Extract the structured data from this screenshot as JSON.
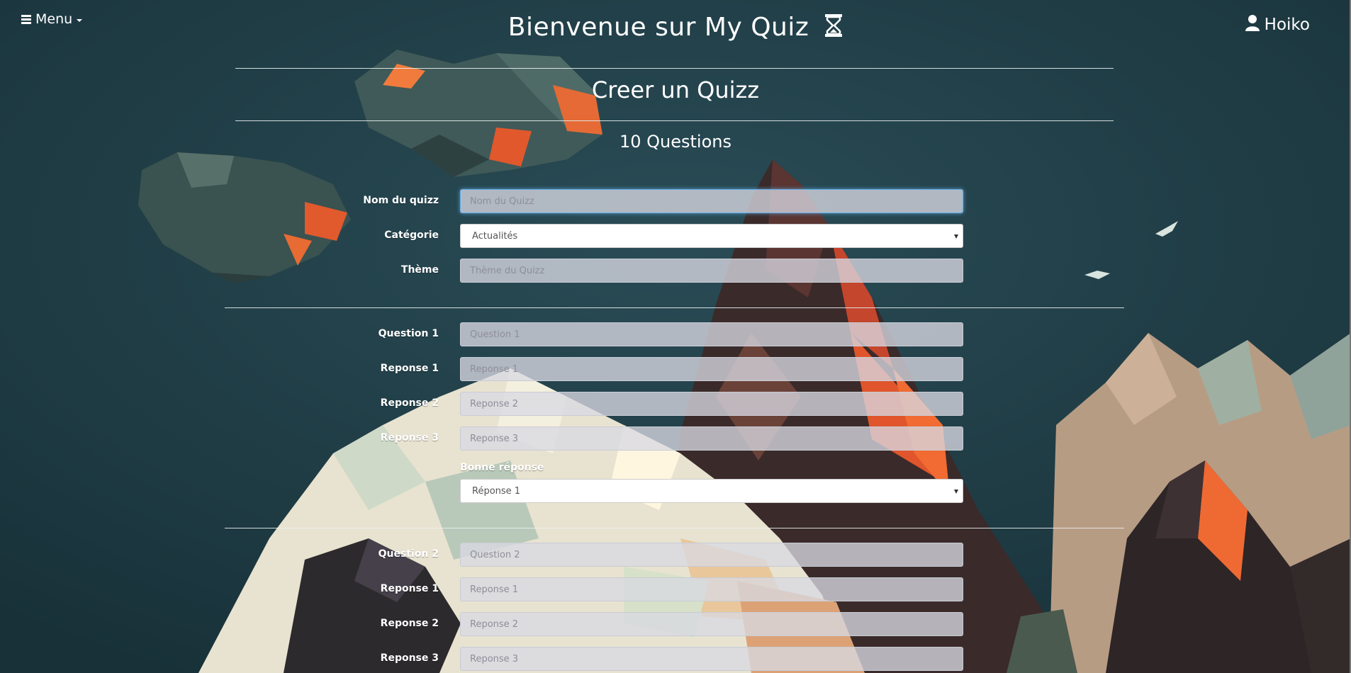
{
  "nav": {
    "menu_label": "Menu",
    "user_name": "Hoiko"
  },
  "site": {
    "title": "Bienvenue sur My Quiz"
  },
  "page": {
    "heading": "Creer un Quizz",
    "question_count": "10 Questions"
  },
  "quiz_meta": {
    "name_label": "Nom du quizz",
    "name_placeholder": "Nom du Quizz",
    "category_label": "Catégorie",
    "category_value": "Actualités",
    "theme_label": "Thème",
    "theme_placeholder": "Thème du Quizz"
  },
  "questions": [
    {
      "question_label": "Question 1",
      "question_placeholder": "Question 1",
      "answers": [
        {
          "label": "Reponse 1",
          "placeholder": "Reponse 1"
        },
        {
          "label": "Reponse 2",
          "placeholder": "Reponse 2"
        },
        {
          "label": "Reponse 3",
          "placeholder": "Reponse 3"
        }
      ],
      "correct_label": "Bonne réponse",
      "correct_value": "Réponse 1"
    },
    {
      "question_label": "Question 2",
      "question_placeholder": "Question 2",
      "answers": [
        {
          "label": "Reponse 1",
          "placeholder": "Reponse 1"
        },
        {
          "label": "Reponse 2",
          "placeholder": "Reponse 2"
        },
        {
          "label": "Reponse 3",
          "placeholder": "Reponse 3"
        }
      ]
    }
  ]
}
